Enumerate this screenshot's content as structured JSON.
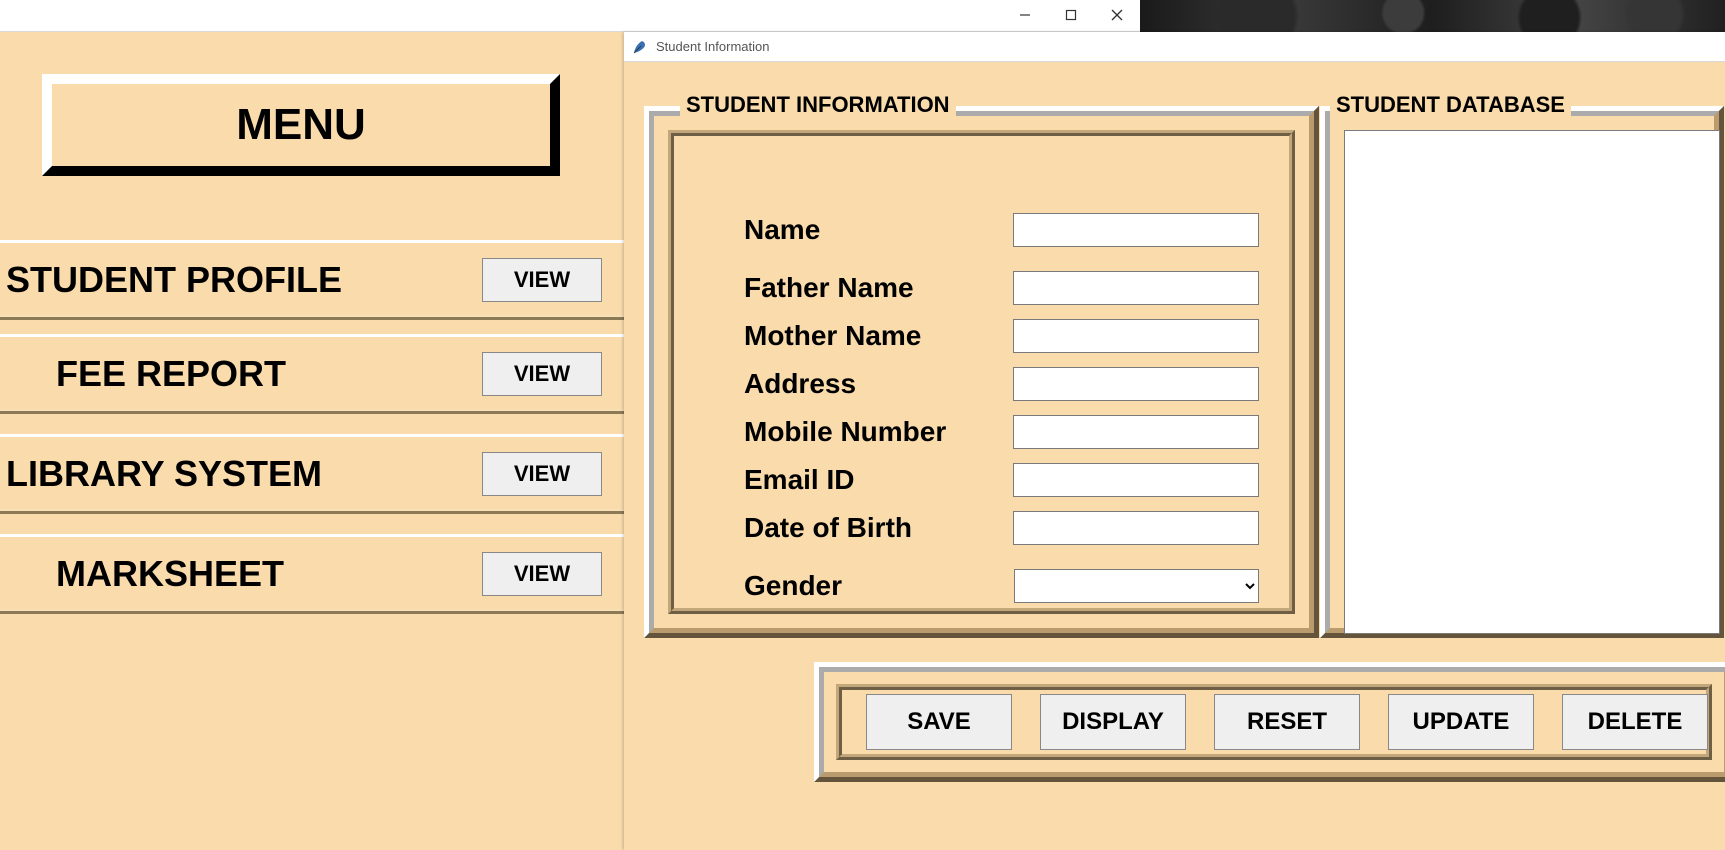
{
  "main_window": {
    "menu_title": "MENU",
    "rows": [
      {
        "label": "STUDENT PROFILE",
        "button": "VIEW"
      },
      {
        "label": "FEE REPORT",
        "button": "VIEW"
      },
      {
        "label": "LIBRARY SYSTEM",
        "button": "VIEW"
      },
      {
        "label": "MARKSHEET",
        "button": "VIEW"
      }
    ]
  },
  "child_window": {
    "title": "Student Information",
    "info_legend": "STUDENT INFORMATION",
    "db_legend": "STUDENT DATABASE",
    "fields": {
      "name": {
        "label": "Name",
        "value": ""
      },
      "father": {
        "label": "Father Name",
        "value": ""
      },
      "mother": {
        "label": "Mother Name",
        "value": ""
      },
      "address": {
        "label": "Address",
        "value": ""
      },
      "mobile": {
        "label": "Mobile Number",
        "value": ""
      },
      "email": {
        "label": "Email ID",
        "value": ""
      },
      "dob": {
        "label": "Date of Birth",
        "value": ""
      },
      "gender": {
        "label": "Gender",
        "value": ""
      }
    },
    "buttons": {
      "save": "SAVE",
      "display": "DISPLAY",
      "reset": "RESET",
      "update": "UPDATE",
      "delete": "DELETE"
    }
  }
}
